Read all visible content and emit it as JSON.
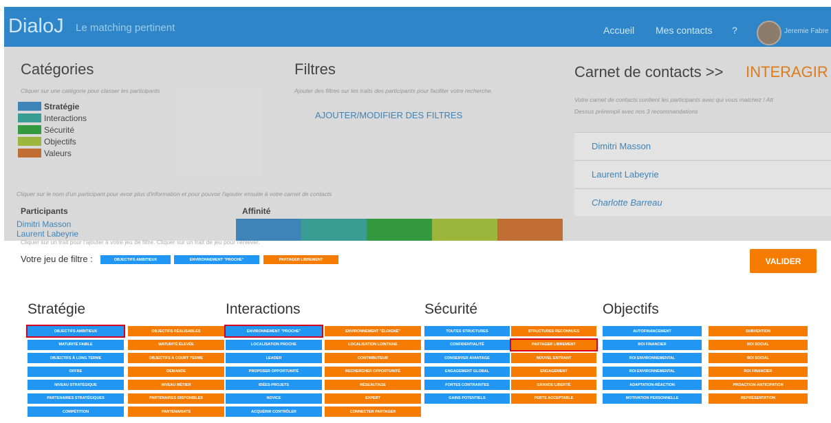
{
  "navbar": {
    "brand": "DialoJ",
    "tagline": "Le matching pertinent",
    "links": [
      "Accueil",
      "Mes contacts",
      "?"
    ],
    "user": "Jeremie Fabre"
  },
  "categories": {
    "title": "Catégories",
    "hint": "Cliquer sur une catégorie pour classer les participants",
    "items": [
      {
        "label": "Stratégie",
        "color": "#2e86c9"
      },
      {
        "label": "Interactions",
        "color": "#26a69a"
      },
      {
        "label": "Sécurité",
        "color": "#1fa22e"
      },
      {
        "label": "Objectifs",
        "color": "#a4c42a"
      },
      {
        "label": "Valeurs",
        "color": "#d2691e"
      }
    ]
  },
  "filters": {
    "title": "Filtres",
    "hint": "Ajouter des filtres sur les traits des participants pour faciliter votre recherche.",
    "add_label": "AJOUTER/MODIFIER DES FILTRES"
  },
  "contacts": {
    "title": "Carnet de contacts >>",
    "action": "INTERAGIR",
    "hint1": "Votre carnet de contacts contient les participants avec qui vous matchez ! Att",
    "hint2": "Dessus prérempli avec nos 3 recommandations",
    "items": [
      "Dimitri Masson",
      "Laurent Labeyrie",
      "Charlotte Barreau"
    ]
  },
  "participants": {
    "hint": "Cliquer sur le nom d'un participant pour avoir plus d'information et pour pouvoir l'ajouter ensuite à votre carnet de contacts",
    "col_participants": "Participants",
    "col_affinity": "Affinité",
    "rows": [
      "Dimitri Masson",
      "Laurent Labeyrie"
    ]
  },
  "modal": {
    "hint": "Cliquer sur un trait pour l'ajouter à votre jeu de filtre. Cliquer sur un trait de jeu pour l'enlever.",
    "jeu_label": "Votre jeu de filtre :",
    "chips": [
      {
        "label": "OBJECTIFS AMBITIEUX",
        "color": "#2196f3"
      },
      {
        "label": "ENVIRONNEMENT \"PROCHE\"",
        "color": "#2196f3"
      },
      {
        "label": "PARTAGER LIBREMENT",
        "color": "#f57c00"
      }
    ],
    "valider": "VALIDER",
    "groups": [
      {
        "title": "Stratégie",
        "left": [
          "OBJECTIFS AMBITIEUX",
          "MATURITÉ FAIBLE",
          "OBJECTIFS À LONG TERME",
          "OFFRE",
          "NIVEAU STRATÉGIQUE",
          "PARTENAIRES STRATÉGIQUES",
          "COMPÉTITION"
        ],
        "right": [
          "OBJECTIFS RÉALISABLES",
          "MATURITÉ ÉLEVÉE",
          "OBJECTIFS À COURT TERME",
          "DEMANDE",
          "NIVEAU MÉTIER",
          "PARTENAIRES DISPONIBLES",
          "PARTENARIATS"
        ]
      },
      {
        "title": "Interactions",
        "left": [
          "ENVIRONNEMENT \"PROCHE\"",
          "LOCALISATION PROCHE",
          "LEADER",
          "PROPOSER OPPORTUNITÉ",
          "IDÉES-PROJETS",
          "NOVICE",
          "ACQUÉRIR CONTRÔLER"
        ],
        "right": [
          "ENVIRONNEMENT \"ÉLOIGNÉ\"",
          "LOCALISATION LOINTAINE",
          "CONTRIBUTEUR",
          "RECHERCHER OPPORTUNITÉ",
          "RÉSEAUTAGE",
          "EXPERT",
          "CONNECTER PARTAGER"
        ]
      },
      {
        "title": "Sécurité",
        "left": [
          "TOUTES STRUCTURES",
          "CONFIDENTIALITÉ",
          "CONSERVER AVANTAGE",
          "ENGAGEMENT GLOBAL",
          "FORTES CONTRAINTES",
          "GAINS POTENTIELS"
        ],
        "right": [
          "STRUCTURES RECONNUES",
          "PARTAGER LIBREMENT",
          "NOUVEL ENTRANT",
          "ENGAGEMENT",
          "GRANDE LIBERTÉ",
          "PERTE ACCEPTABLE"
        ]
      },
      {
        "title": "Objectifs",
        "left": [
          "AUTOFINANCEMENT",
          "ROI FINANCIER",
          "ROI ENVIRONNEMENTAL",
          "ROI ENVIRONNEMENTAL",
          "ADAPTATION-RÉACTION",
          "MOTIVATION PERSONNELLE"
        ],
        "right": [
          "SUBVENTION",
          "ROI SOCIAL",
          "ROI SOCIAL",
          "ROI FINANCIER",
          "PROACTION-ANTICIPATION",
          "REPRÉSENTATION"
        ]
      }
    ],
    "selected": [
      "OBJECTIFS AMBITIEUX",
      "ENVIRONNEMENT \"PROCHE\"",
      "PARTAGER LIBREMENT"
    ]
  }
}
